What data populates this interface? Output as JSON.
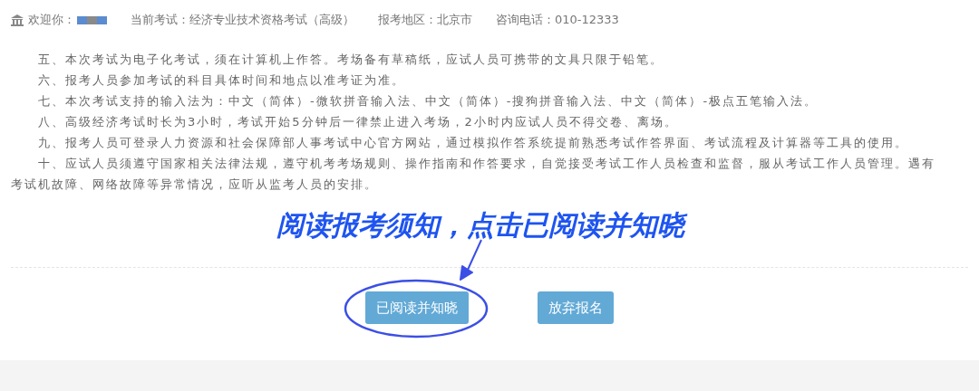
{
  "header": {
    "welcome_label": "欢迎你：",
    "items": [
      {
        "label": "当前考试：经济专业技术资格考试（高级）"
      },
      {
        "label": "报考地区：北京市"
      },
      {
        "label": "咨询电话：010-12333"
      }
    ]
  },
  "notices": [
    "五、本次考试为电子化考试，须在计算机上作答。考场备有草稿纸，应试人员可携带的文具只限于铅笔。",
    "六、报考人员参加考试的科目具体时间和地点以准考证为准。",
    "七、本次考试支持的输入法为：中文（简体）-微软拼音输入法、中文（简体）-搜狗拼音输入法、中文（简体）-极点五笔输入法。",
    "八、高级经济考试时长为3小时，考试开始5分钟后一律禁止进入考场，2小时内应试人员不得交卷、离场。",
    "九、报考人员可登录人力资源和社会保障部人事考试中心官方网站，通过模拟作答系统提前熟悉考试作答界面、考试流程及计算器等工具的使用。",
    "十、应试人员须遵守国家相关法律法规，遵守机考考场规则、操作指南和作答要求，自觉接受考试工作人员检查和监督，服从考试工作人员管理。遇有考试机故障、网络故障等异常情况，应听从监考人员的安排。"
  ],
  "annotation": {
    "text": "阅读报考须知，点击已阅读并知晓"
  },
  "buttons": [
    {
      "label": "已阅读并知晓",
      "highlighted": true
    },
    {
      "label": "放弃报名",
      "highlighted": false
    }
  ]
}
